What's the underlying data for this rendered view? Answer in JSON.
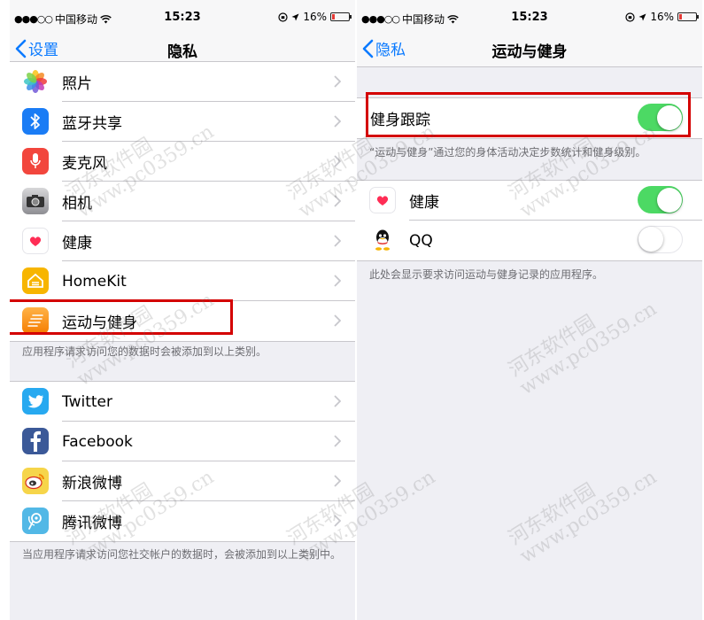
{
  "left": {
    "status": {
      "carrier": "中国移动",
      "time": "15:23",
      "battery": "16%"
    },
    "nav": {
      "back_label": "设置",
      "title": "隐私"
    },
    "group1": [
      {
        "label": "照片",
        "icon": "photos-icon"
      },
      {
        "label": "蓝牙共享",
        "icon": "bluetooth-icon"
      },
      {
        "label": "麦克风",
        "icon": "microphone-icon"
      },
      {
        "label": "相机",
        "icon": "camera-icon"
      },
      {
        "label": "健康",
        "icon": "health-icon"
      },
      {
        "label": "HomeKit",
        "icon": "homekit-icon"
      },
      {
        "label": "运动与健身",
        "icon": "motion-fitness-icon"
      }
    ],
    "group1_footer": "应用程序请求访问您的数据时会被添加到以上类别。",
    "group2": [
      {
        "label": "Twitter",
        "icon": "twitter-icon"
      },
      {
        "label": "Facebook",
        "icon": "facebook-icon"
      },
      {
        "label": "新浪微博",
        "icon": "weibo-icon"
      },
      {
        "label": "腾讯微博",
        "icon": "tencent-weibo-icon"
      }
    ],
    "group2_footer": "当应用程序请求访问您社交帐户的数据时，会被添加到以上类别中。"
  },
  "right": {
    "status": {
      "carrier": "中国移动",
      "time": "15:23",
      "battery": "16%"
    },
    "nav": {
      "back_label": "隐私",
      "title": "运动与健身"
    },
    "tracking": {
      "label": "健身跟踪",
      "on": true
    },
    "tracking_footer": "“运动与健身”通过您的身体活动决定步数统计和健身级别。",
    "apps": [
      {
        "label": "健康",
        "icon": "health-icon",
        "on": true
      },
      {
        "label": "QQ",
        "icon": "qq-icon",
        "on": false
      }
    ],
    "apps_footer": "此处会显示要求访问运动与健身记录的应用程序。"
  },
  "watermark": {
    "line1": "河东软件园",
    "line2": "www.pc0359.cn"
  },
  "colors": {
    "accent": "#0a7aff",
    "toggle_on": "#4cd964",
    "highlight": "#d40000"
  }
}
